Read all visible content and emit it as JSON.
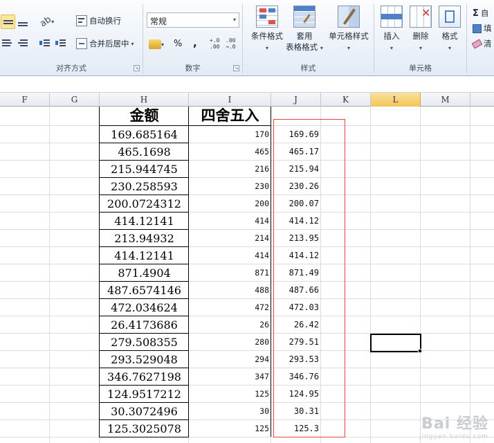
{
  "ribbon": {
    "alignment": {
      "wrap_text_label": "自动换行",
      "merge_center_label": "合并后居中",
      "group_label": "对齐方式"
    },
    "number": {
      "format_value": "常规",
      "percent_symbol": "%",
      "comma_symbol": ",",
      "inc_decimal_label": "+.0 .00",
      "dec_decimal_label": ".00 →.0",
      "group_label": "数字"
    },
    "styles": {
      "conditional_format_label": "条件格式",
      "format_table_line1": "套用",
      "format_table_line2": "表格格式",
      "cell_styles_label": "单元格样式",
      "group_label": "样式"
    },
    "cells": {
      "insert_label": "插入",
      "delete_label": "删除",
      "format_label": "格式",
      "group_label": "单元格"
    },
    "editing": {
      "autosum_label": "自",
      "fill_label": "填",
      "clear_label": "清",
      "sigma_symbol": "Σ"
    }
  },
  "columns": [
    "F",
    "G",
    "H",
    "I",
    "J",
    "K",
    "L",
    "M"
  ],
  "selected_column": "L",
  "headers": {
    "amount": "金额",
    "rounded": "四舍五入"
  },
  "rows": [
    {
      "amount": "169.685164",
      "rounded": "170",
      "round2": "169.69"
    },
    {
      "amount": "465.1698",
      "rounded": "465",
      "round2": "465.17"
    },
    {
      "amount": "215.944745",
      "rounded": "216",
      "round2": "215.94"
    },
    {
      "amount": "230.258593",
      "rounded": "230",
      "round2": "230.26"
    },
    {
      "amount": "200.0724312",
      "rounded": "200",
      "round2": "200.07"
    },
    {
      "amount": "414.12141",
      "rounded": "414",
      "round2": "414.12"
    },
    {
      "amount": "213.94932",
      "rounded": "214",
      "round2": "213.95"
    },
    {
      "amount": "414.12141",
      "rounded": "414",
      "round2": "414.12"
    },
    {
      "amount": "871.4904",
      "rounded": "871",
      "round2": "871.49"
    },
    {
      "amount": "487.6574146",
      "rounded": "488",
      "round2": "487.66"
    },
    {
      "amount": "472.034624",
      "rounded": "472",
      "round2": "472.03"
    },
    {
      "amount": "26.4173686",
      "rounded": "26",
      "round2": "26.42"
    },
    {
      "amount": "279.508355",
      "rounded": "280",
      "round2": "279.51"
    },
    {
      "amount": "293.529048",
      "rounded": "294",
      "round2": "293.53"
    },
    {
      "amount": "346.7627198",
      "rounded": "347",
      "round2": "346.76"
    },
    {
      "amount": "124.9517212",
      "rounded": "125",
      "round2": "124.95"
    },
    {
      "amount": "30.3072496",
      "rounded": "30",
      "round2": "30.31"
    },
    {
      "amount": "125.3025078",
      "rounded": "125",
      "round2": "125.3"
    }
  ],
  "watermark": {
    "brand": "Bai 经验",
    "url": "jingyan.baidu.com"
  },
  "colors": {
    "highlight_box": "#e8453c",
    "selected_column_header": "#f3c25a"
  }
}
